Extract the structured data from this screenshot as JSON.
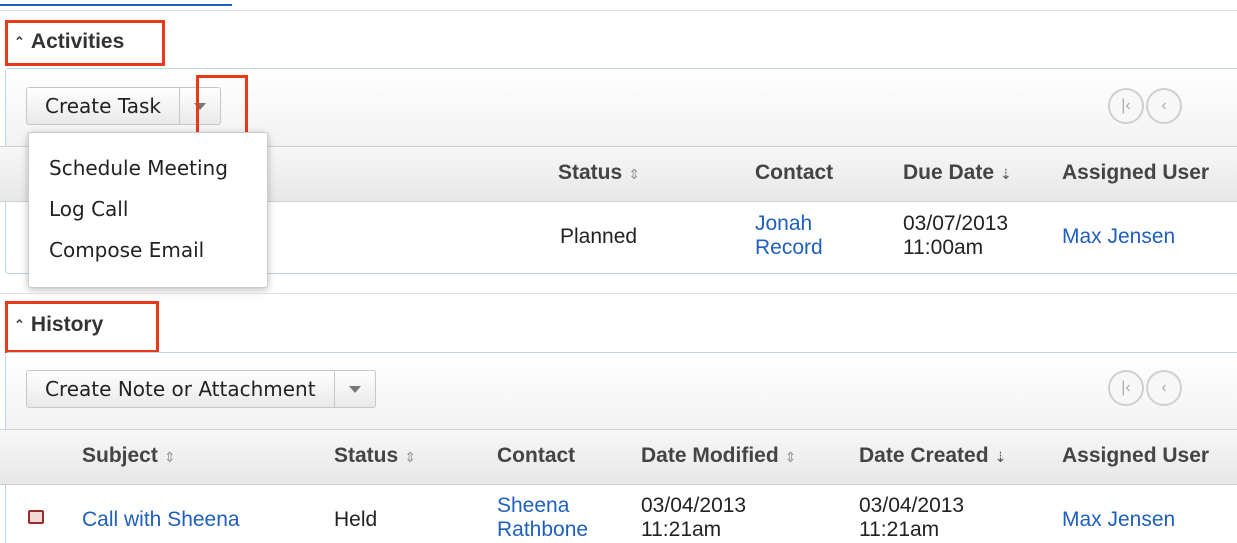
{
  "activities": {
    "title": "Activities",
    "create_button": "Create Task",
    "dropdown_items": [
      "Schedule Meeting",
      "Log Call",
      "Compose Email"
    ],
    "columns": {
      "status": "Status",
      "contact": "Contact",
      "due_date": "Due Date",
      "assigned_user": "Assigned User"
    },
    "rows": [
      {
        "status": "Planned",
        "contact_first": "Jonah",
        "contact_last": "Record",
        "due_date": "03/07/2013",
        "due_time": "11:00am",
        "assigned_user": "Max Jensen"
      }
    ]
  },
  "history": {
    "title": "History",
    "create_button": "Create Note or Attachment",
    "columns": {
      "subject": "Subject",
      "status": "Status",
      "contact": "Contact",
      "date_modified": "Date Modified",
      "date_created": "Date Created",
      "assigned_user": "Assigned User"
    },
    "rows": [
      {
        "subject": "Call with Sheena",
        "status": "Held",
        "contact_first": "Sheena",
        "contact_last": "Rathbone",
        "modified_date": "03/04/2013",
        "modified_time": "11:21am",
        "created_date": "03/04/2013",
        "created_time": "11:21am",
        "assigned_user": "Max Jensen"
      }
    ]
  },
  "colors": {
    "link": "#1f5fbf",
    "highlight": "#e8391d",
    "panel_border": "#b9d3e8"
  }
}
